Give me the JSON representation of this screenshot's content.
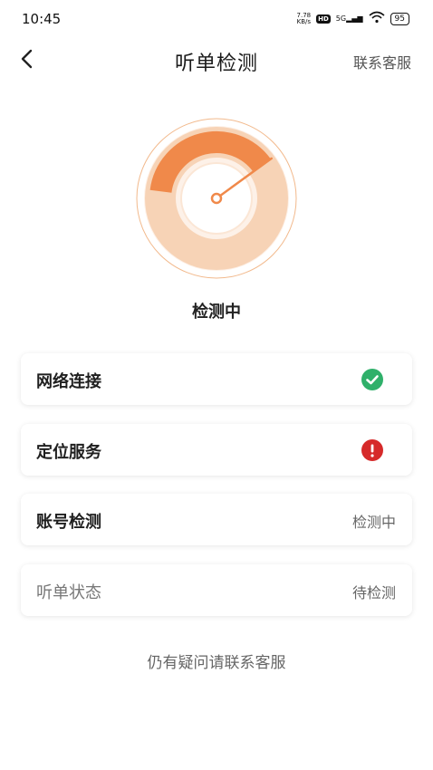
{
  "status_bar": {
    "time": "10:45",
    "net_speed": "7.78\nKB/s",
    "hd": "HD",
    "signal": "5G",
    "battery": "95"
  },
  "header": {
    "title": "听单检测",
    "contact_label": "联系客服"
  },
  "gauge": {
    "status_text": "检测中",
    "progress": 0.38,
    "colors": {
      "arc": "#f0894a",
      "track": "#f7d3b6",
      "inner": "#fbe6d5"
    }
  },
  "checks": [
    {
      "label": "网络连接",
      "status": "ok",
      "icon": "check-icon"
    },
    {
      "label": "定位服务",
      "status": "error",
      "icon": "exclamation-icon"
    },
    {
      "label": "账号检测",
      "value": "检测中"
    },
    {
      "label": "听单状态",
      "value": "待检测"
    }
  ],
  "footer_text": "仍有疑问请联系客服"
}
